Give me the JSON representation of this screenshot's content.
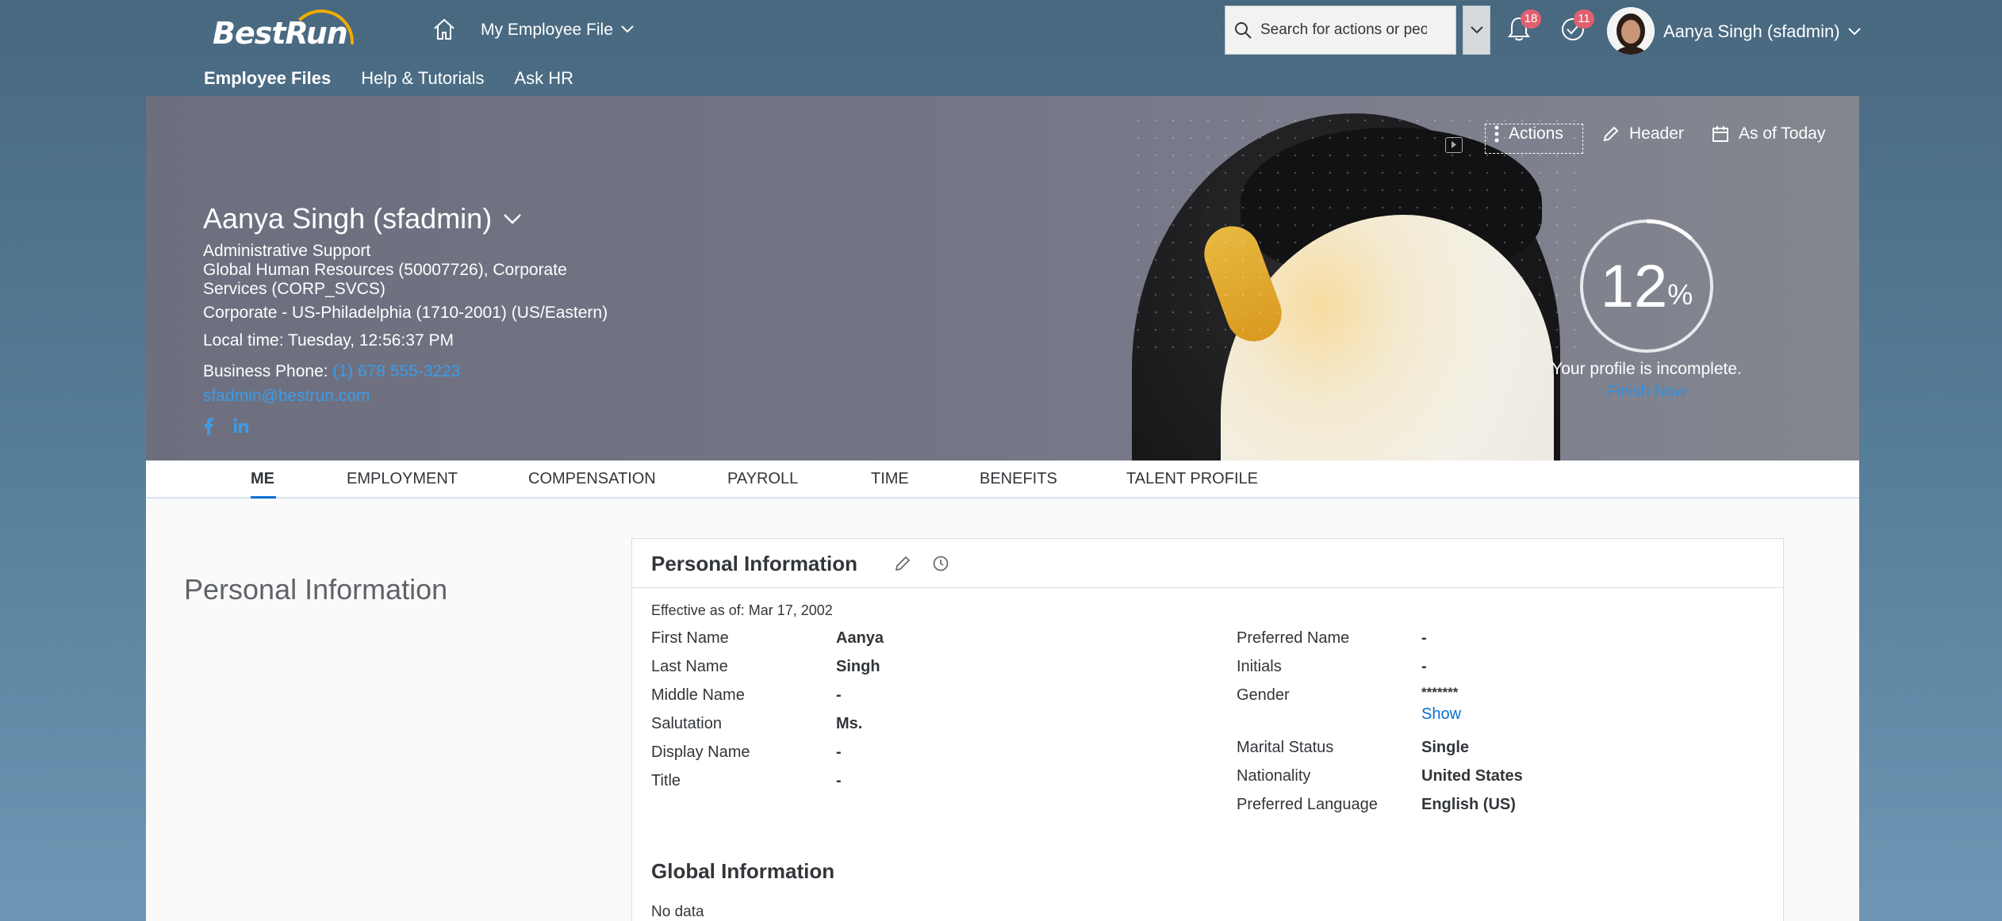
{
  "shell": {
    "logo_text": "BestRun",
    "nav_title": "My Employee File",
    "search_placeholder": "Search for actions or people",
    "notifications_count": "18",
    "todos_count": "11",
    "user_name": "Aanya Singh (sfadmin)"
  },
  "subnav": {
    "items": [
      "Employee Files",
      "Help & Tutorials",
      "Ask HR"
    ]
  },
  "header": {
    "name": "Aanya Singh (sfadmin)",
    "job_title": "Administrative Support",
    "department_line1": "Global Human Resources (50007726), Corporate",
    "department_line2": "Services (CORP_SVCS)",
    "location": "Corporate - US-Philadelphia (1710-2001) (US/Eastern)",
    "local_time": "Local time: Tuesday, 12:56:37 PM",
    "phone_label": "Business Phone:",
    "phone": "(1) 678 555-3223",
    "email": "sfadmin@bestrun.com",
    "actions_label": "Actions",
    "header_label": "Header",
    "as_of_label": "As of Today",
    "profile_percent": "12",
    "profile_percent_symbol": "%",
    "profile_status": "Your profile is incomplete.",
    "finish_link": "Finish Now"
  },
  "tabs": [
    "ME",
    "EMPLOYMENT",
    "COMPENSATION",
    "PAYROLL",
    "TIME",
    "BENEFITS",
    "TALENT PROFILE"
  ],
  "section": {
    "title": "Personal Information"
  },
  "card": {
    "title": "Personal Information",
    "effective": "Effective as of: Mar 17, 2002",
    "left_fields": [
      {
        "label": "First Name",
        "value": "Aanya"
      },
      {
        "label": "Last Name",
        "value": "Singh"
      },
      {
        "label": "Middle Name",
        "value": "-"
      },
      {
        "label": "Salutation",
        "value": "Ms."
      },
      {
        "label": "Display Name",
        "value": "-"
      },
      {
        "label": "Title",
        "value": "-"
      }
    ],
    "right_fields": [
      {
        "label": "Preferred Name",
        "value": "-"
      },
      {
        "label": "Initials",
        "value": "-"
      },
      {
        "label": "Gender",
        "value": "*******"
      },
      {
        "label": "Marital Status",
        "value": "Single"
      },
      {
        "label": "Nationality",
        "value": "United States"
      },
      {
        "label": "Preferred Language",
        "value": "English (US)"
      }
    ],
    "show_link": "Show",
    "global_title": "Global Information",
    "global_empty": "No data"
  },
  "colors": {
    "accent": "#0a6ed1",
    "badge": "#e06070",
    "shell_bg": "#48687f"
  }
}
